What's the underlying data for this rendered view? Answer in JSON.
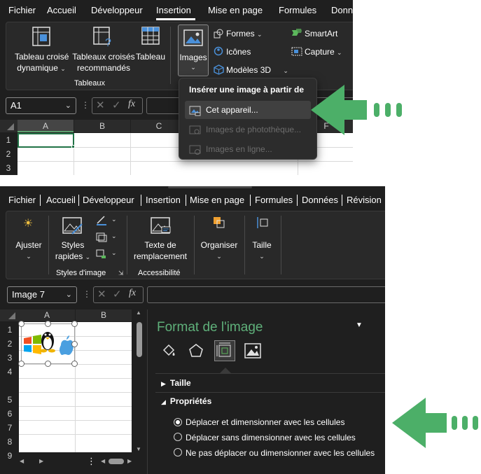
{
  "top": {
    "menu": [
      "Fichier",
      "Accueil",
      "Développeur",
      "Insertion",
      "Mise en page",
      "Formules",
      "Donn"
    ],
    "active_tab": "Insertion",
    "ribbon": {
      "pivot_label1": "Tableau croisé",
      "pivot_label2": "dynamique",
      "rec_pivot_label1": "Tableaux croisés",
      "rec_pivot_label2": "recommandés",
      "table_label": "Tableau",
      "group_tableaux": "Tableaux",
      "images_label": "Images",
      "formes_label": "Formes",
      "icones_label": "Icônes",
      "modeles3d_label": "Modèles 3D",
      "smartart_label": "SmartArt",
      "capture_label": "Capture"
    },
    "namebox_value": "A1",
    "columns": [
      "A",
      "B",
      "C",
      "F"
    ],
    "rows": [
      "1",
      "2",
      "3"
    ],
    "dropdown": {
      "heading": "Insérer une image à partir de",
      "items": [
        "Cet appareil...",
        "Images de photothèque...",
        "Images en ligne..."
      ]
    }
  },
  "bottom": {
    "menu": [
      "Fichier",
      "Accueil",
      "Développeur",
      "Insertion",
      "Mise en page",
      "Formules",
      "Données",
      "Révision"
    ],
    "ribbon": {
      "ajuster_label": "Ajuster",
      "styles_label1": "Styles",
      "styles_label2": "rapides",
      "group_styles": "Styles d'image",
      "alt_label1": "Texte de",
      "alt_label2": "remplacement",
      "group_access": "Accessibilité",
      "organiser_label": "Organiser",
      "taille_label": "Taille"
    },
    "namebox_value": "Image 7",
    "columns": [
      "A",
      "B"
    ],
    "rows": [
      "1",
      "2",
      "3",
      "4",
      "5",
      "6",
      "7",
      "8",
      "9"
    ],
    "format_pane": {
      "title": "Format de l'image",
      "section_taille": "Taille",
      "section_proprietes": "Propriétés",
      "options": [
        "Déplacer et dimensionner avec les cellules",
        "Déplacer sans dimensionner avec les cellules",
        "Ne pas déplacer ou dimensionner avec les cellules"
      ],
      "selected_option": 0
    }
  },
  "colors": {
    "arrow_green": "#4caf68",
    "selection_green": "#217346",
    "bg_dark": "#1f1f1f"
  }
}
